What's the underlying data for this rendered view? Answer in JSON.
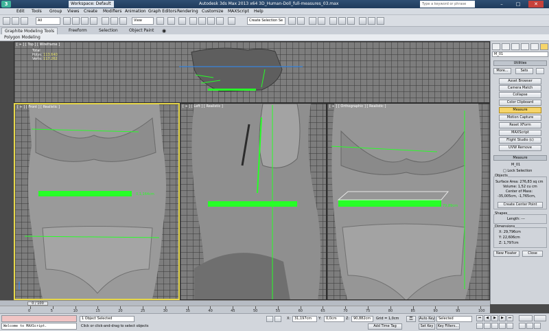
{
  "app": {
    "title": "Autodesk 3ds Max 2013 x64     3D_Human-Doll_full-measures_03.max",
    "workspace": "Workspace: Default",
    "search_placeholder": "Type a keyword or phrase"
  },
  "menu": [
    "Edit",
    "Tools",
    "Group",
    "Views",
    "Create",
    "Modifiers",
    "Animation",
    "Graph Editors",
    "Rendering",
    "Customize",
    "MAXScript",
    "Help"
  ],
  "toolbar": {
    "filter": "All",
    "ref_coord": "View",
    "selection_set": "Create Selection Se"
  },
  "ribbon": {
    "tabs": [
      "Graphite Modeling Tools",
      "Freeform",
      "Selection",
      "Object Paint"
    ],
    "sub_label": "Polygon Modeling"
  },
  "viewports": {
    "top": {
      "label": "[ + ] [ Top ] [ Wireframe ]"
    },
    "front": {
      "label": "[ + ] [ Front ] [ Realistic ]",
      "measure": "0,1,164cm"
    },
    "left": {
      "label": "[ + ] [ Left ] [ Realistic ]"
    },
    "ortho": {
      "label": "[ + ] [ Orthographic ] [ Realistic ]",
      "measure": "79,89cm"
    }
  },
  "stats": {
    "total_label": "Total",
    "polys_label": "Polys:",
    "polys_value": "113.640",
    "verts_label": "Verts:",
    "verts_value": "117.262"
  },
  "command_panel": {
    "object_name": "M_01",
    "utilities_header": "Utilities",
    "more_btn": "More...",
    "sets_btn": "Sets",
    "utility_buttons": [
      "Asset Browser",
      "Camera Match",
      "Collapse",
      "Color Clipboard",
      "Measure",
      "Motion Capture",
      "Reset XForm",
      "MAXScript",
      "Flight Studio (c)",
      "UVW Remove"
    ],
    "active_utility": "Measure",
    "measure_header": "Measure",
    "measure_object": "M_01",
    "lock_selection": "Lock Selection",
    "objects_label": "Objects",
    "surface_area": "Surface Area:  276,83 sq cm",
    "volume": "Volume:  1,52 cu cm",
    "center_label": "Center of Mass:",
    "center_value": "-35,005cm, -1,765cm,",
    "create_center": "Create Center Point",
    "shapes_label": "Shapes",
    "length": "Length: ---",
    "dimensions_label": "Dimensions",
    "dim_x": "X:   29,796cm",
    "dim_y": "Y:   22,606cm",
    "dim_z": "Z:   1,797cm",
    "new_floater": "New Floater",
    "close": "Close"
  },
  "timeline": {
    "frame": "0 / 100",
    "ticks": [
      "0",
      "5",
      "10",
      "15",
      "20",
      "25",
      "30",
      "35",
      "40",
      "45",
      "50",
      "55",
      "60",
      "65",
      "70",
      "75",
      "80",
      "85",
      "90",
      "95",
      "100"
    ]
  },
  "status": {
    "listener_text": "Welcome to MAXScript.",
    "selected": "1 Object Selected",
    "prompt": "Click or click-and-drag to select objects",
    "x_label": "X:",
    "x_value": "31,197cm",
    "y_label": "Y:",
    "y_value": "0,0cm",
    "z_label": "Z:",
    "z_value": "90,882cm",
    "grid": "Grid = 1,0cm",
    "add_time_tag": "Add Time Tag",
    "auto_key": "Auto Key",
    "set_key": "Set Key",
    "key_mode": "Selected",
    "key_filters": "Key Filters..."
  }
}
